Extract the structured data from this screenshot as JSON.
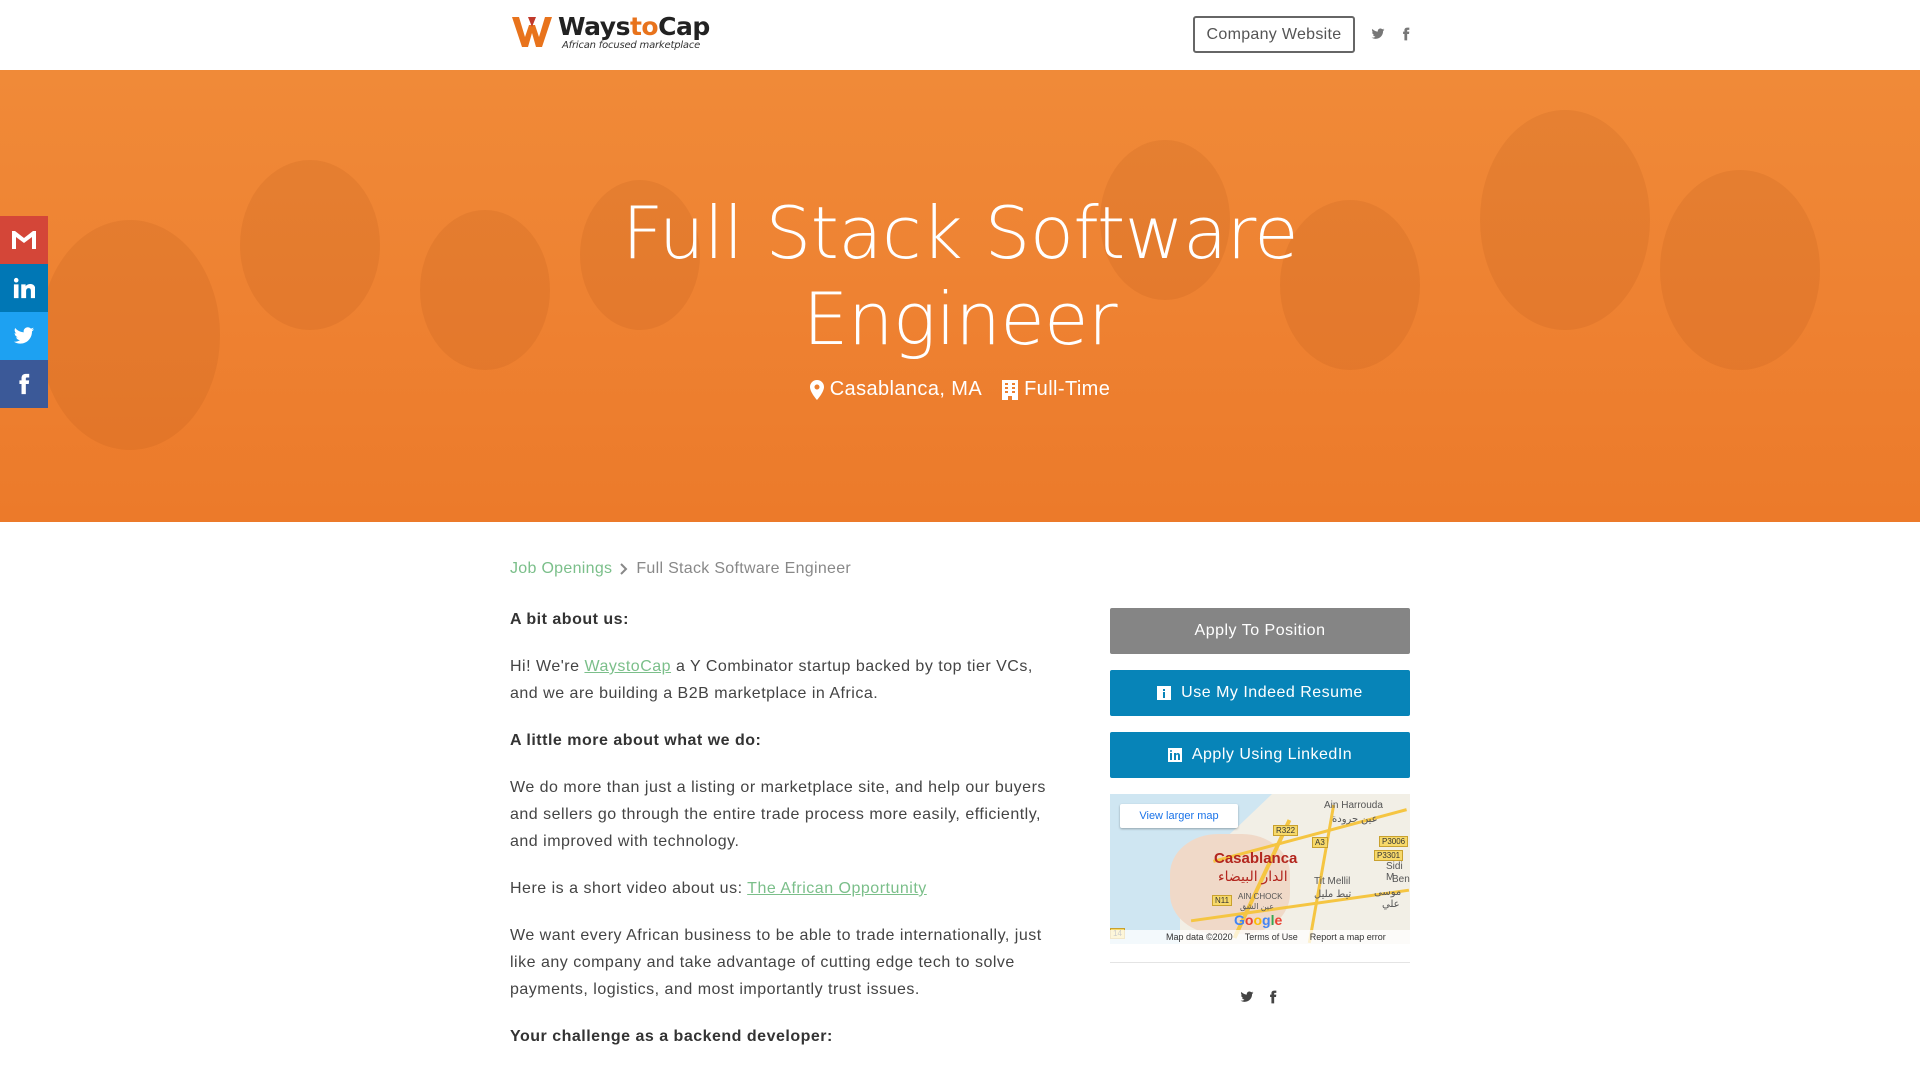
{
  "header": {
    "logo": {
      "name_part1": "Ways",
      "name_part2": "to",
      "name_part3": "Cap",
      "tagline": "African focused marketplace"
    },
    "company_website_label": "Company Website",
    "social": [
      {
        "icon": "twitter-icon"
      },
      {
        "icon": "facebook-icon"
      }
    ]
  },
  "hero": {
    "title_line1": "Full Stack Software",
    "title_line2": "Engineer",
    "location": "Casablanca, MA",
    "job_type": "Full-Time"
  },
  "side_share": [
    {
      "icon": "gmail-icon",
      "color": "#d44638"
    },
    {
      "icon": "linkedin-icon",
      "color": "#0077b5"
    },
    {
      "icon": "twitter-icon",
      "color": "#1da1f2"
    },
    {
      "icon": "facebook-icon",
      "color": "#3b5998"
    }
  ],
  "breadcrumb": {
    "parent": "Job Openings",
    "current": "Full Stack Software Engineer"
  },
  "content": {
    "h1": "A bit about us:",
    "p1_pre": "Hi! We're ",
    "p1_link": "WaystoCap",
    "p1_post": " a Y Combinator startup backed by top tier VCs, and we are building a B2B marketplace in Africa.",
    "h2": "A little more about what we do:",
    "p2": "We do more than just a listing or marketplace site, and help our buyers and sellers go through the entire trade process more easily, efficiently, and improved with technology.",
    "p3_pre": "Here is a short video about us: ",
    "p3_link": "The African Opportunity",
    "p4": "We want every African business to be able to trade internationally, just like any company and take advantage of cutting edge tech to solve payments, logistics, and most importantly trust issues.",
    "h3": "Your challenge as a backend developer:"
  },
  "aside": {
    "apply_label": "Apply To Position",
    "indeed_label": "Use My Indeed Resume",
    "linkedin_label": "Apply Using LinkedIn",
    "map": {
      "view_larger": "View larger map",
      "city": "Casablanca",
      "city_ar": "الدار البيضاء",
      "labels": {
        "ain_harrouda": "Ain Harrouda",
        "ain_harrouda_ar": "عين حرودة",
        "tit_mellil": "Tit Mellil",
        "tit_mellil_ar": "تيط مليل",
        "ain_chock": "AIN CHOCK",
        "ain_chock_ar": "عين الشق",
        "sidi": "Sidi M",
        "ben": "Ben",
        "moussa_ar": "موسى",
        "ali_ar": "علي"
      },
      "shields": {
        "r322": "R322",
        "a3": "A3",
        "p3006": "P3006",
        "p3301": "P3301",
        "n11": "N11",
        "n14": "14"
      },
      "footer_data": "Map data ©2020",
      "footer_terms": "Terms of Use",
      "footer_report": "Report a map error",
      "google": [
        "G",
        "o",
        "o",
        "g",
        "l",
        "e"
      ]
    },
    "social": [
      {
        "icon": "twitter-icon"
      },
      {
        "icon": "facebook-icon"
      }
    ]
  },
  "colors": {
    "brand_orange": "#ee8232",
    "link_green": "#7bbf8a",
    "button_blue": "#0784b8",
    "button_gray": "#858585"
  }
}
